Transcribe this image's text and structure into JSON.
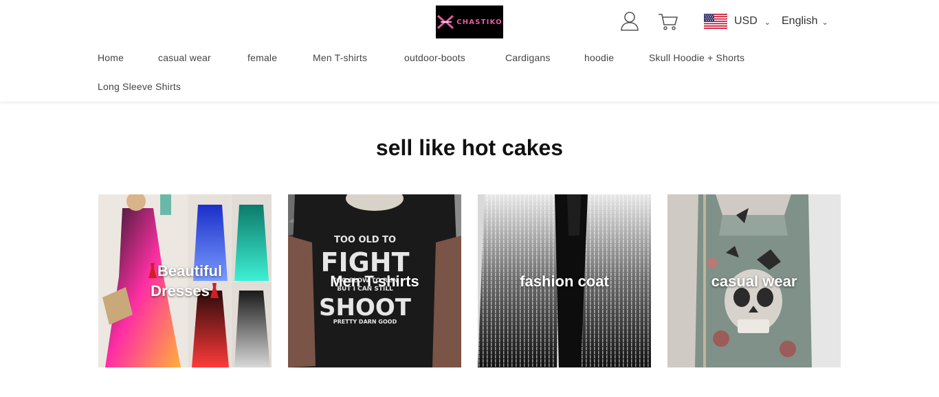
{
  "brand": {
    "logo_text": "CHASTIKO"
  },
  "header": {
    "currency": {
      "label": "USD"
    },
    "language": {
      "label": "English"
    }
  },
  "nav": {
    "items": [
      {
        "label": "Home"
      },
      {
        "label": "casual wear"
      },
      {
        "label": "female"
      },
      {
        "label": "Men T-shirts"
      },
      {
        "label": "outdoor-boots"
      },
      {
        "label": "Cardigans"
      },
      {
        "label": "hoodie"
      },
      {
        "label": "Skull Hoodie + Shorts"
      },
      {
        "label": "Long Sleeve Shirts"
      }
    ]
  },
  "section": {
    "title": "sell like hot cakes"
  },
  "categories": [
    {
      "label": "Beautiful",
      "label2": "Dresses",
      "icon": "red-dress-icon"
    },
    {
      "label": "Men T-shirts",
      "shirt_lines": [
        "TOO OLD TO",
        "FIGHT",
        "TOO SLOW TO RUN",
        "BUT I CAN STILL",
        "SHOOT",
        "PRETTY DARN GOOD"
      ]
    },
    {
      "label": "fashion coat"
    },
    {
      "label": "casual wear"
    }
  ],
  "colors": {
    "accent": "#e85aa3",
    "text": "#222222",
    "dress_icon": "#d21f26"
  }
}
